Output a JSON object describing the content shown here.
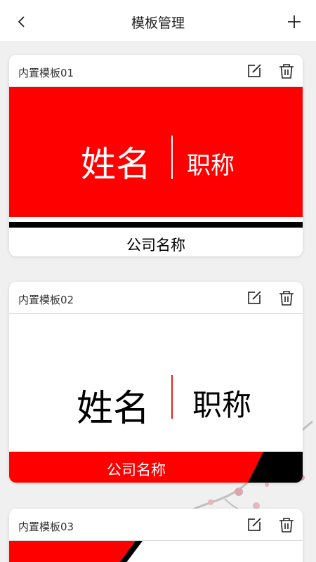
{
  "header": {
    "title": "模板管理",
    "back_icon": "chevron-left-icon",
    "add_icon": "plus-icon"
  },
  "templates": [
    {
      "name": "内置模板01",
      "preview": {
        "person_name": "姓名",
        "job_title": "职称",
        "company": "公司名称"
      }
    },
    {
      "name": "内置模板02",
      "preview": {
        "person_name": "姓名",
        "job_title": "职称",
        "company": "公司名称"
      }
    },
    {
      "name": "内置模板03"
    }
  ],
  "colors": {
    "accent_red": "#ff0000",
    "black": "#000000",
    "background": "#f0f0f0"
  }
}
